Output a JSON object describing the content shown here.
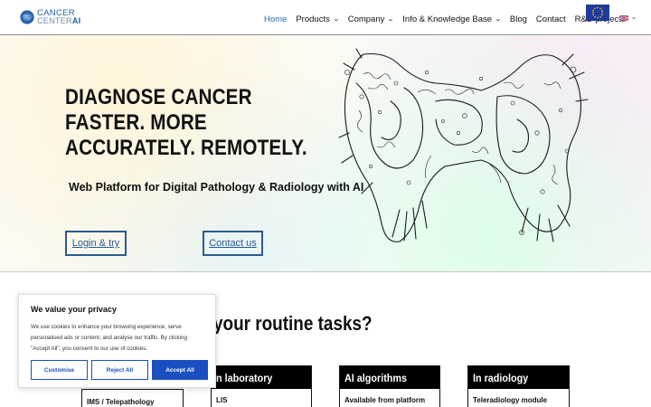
{
  "header": {
    "logo_line1": "CANCER",
    "logo_line2": "CENTER",
    "logo_ai": "AI",
    "nav": [
      {
        "label": "Home",
        "dropdown": false,
        "active": true
      },
      {
        "label": "Products",
        "dropdown": true
      },
      {
        "label": "Company",
        "dropdown": true
      },
      {
        "label": "Info & Knowledge Base",
        "dropdown": true
      },
      {
        "label": "Blog",
        "dropdown": false
      },
      {
        "label": "Contact",
        "dropdown": false
      },
      {
        "label": "R&D projects",
        "dropdown": false
      }
    ],
    "colors": {
      "active": "#2b6fb2",
      "brand": "#1f5fa3"
    }
  },
  "hero": {
    "headline": [
      "DIAGNOSE CANCER",
      "FASTER. MORE",
      "ACCURATELY. REMOTELY."
    ],
    "subtitle": "Web Platform for Digital Pathology & Radiology with AI",
    "login_button": "Login & try",
    "contact_button": "Contact us"
  },
  "section": {
    "question": "your routine tasks?",
    "ims_label": "IMS / Telepathology",
    "cards": [
      {
        "title": "n laboratory",
        "subtitle": "LIS"
      },
      {
        "title": "AI algorithms",
        "subtitle": "Available from platform"
      },
      {
        "title": "In radiology",
        "subtitle": "Teleradiology module"
      }
    ]
  },
  "cookie": {
    "title": "We value your privacy",
    "text": "We use cookies to enhance your browsing experience, serve personalised ads or content, and analyse our traffic. By clicking \"Accept All\", you consent to our use of cookies.",
    "customise": "Customise",
    "reject": "Reject All",
    "accept": "Accept All",
    "accent": "#1a4fc0"
  }
}
